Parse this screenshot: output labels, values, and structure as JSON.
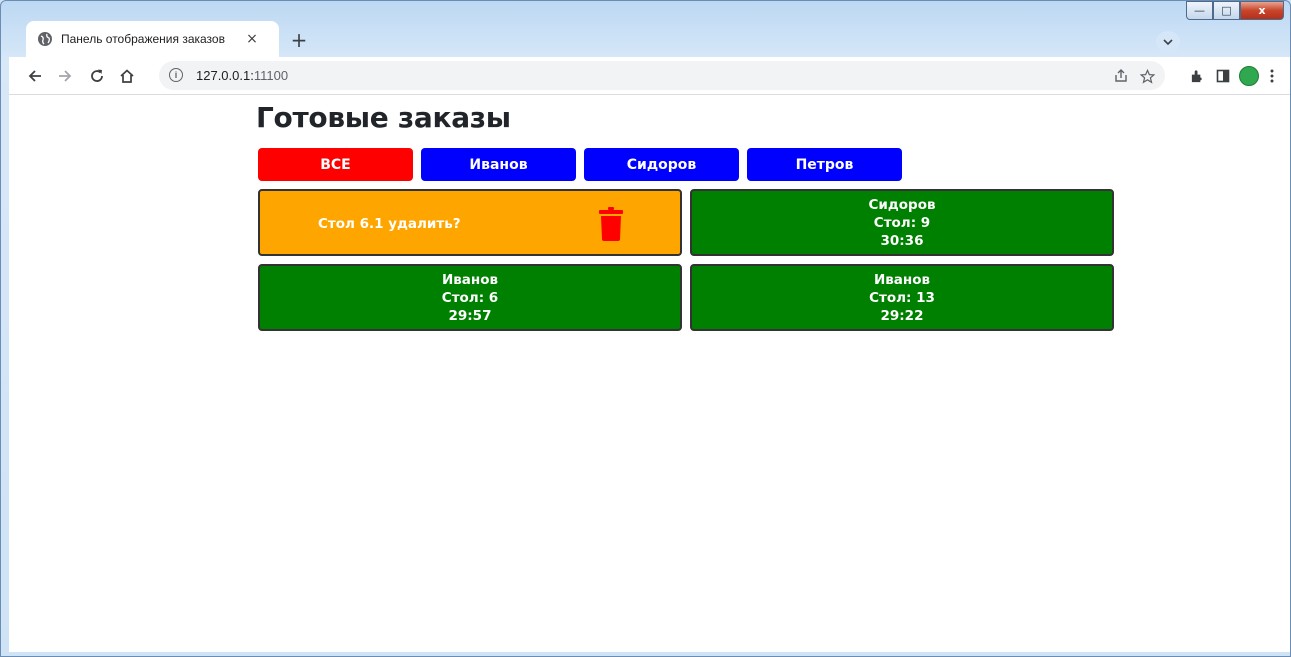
{
  "browser": {
    "tab_title": "Панель отображения заказов",
    "tab_close": "×",
    "new_tab": "+",
    "url_host": "127.0.0.1:",
    "url_port": "11100",
    "window_buttons": {
      "minimize": "—",
      "maximize": "□",
      "close": "x"
    }
  },
  "page": {
    "title": "Готовые заказы",
    "filters": [
      {
        "label": "ВСЕ",
        "color": "#ff0000"
      },
      {
        "label": "Иванов",
        "color": "#0000ff"
      },
      {
        "label": "Сидоров",
        "color": "#0000ff"
      },
      {
        "label": "Петров",
        "color": "#0000ff"
      }
    ],
    "confirm_card": {
      "text": "Стол 6.1 удалить?",
      "color": "#ffa500",
      "icon": "trash-icon"
    },
    "orders": [
      {
        "waiter": "Сидоров",
        "table": "Стол: 9",
        "time": "30:36",
        "color": "#008000"
      },
      {
        "waiter": "Иванов",
        "table": "Стол: 6",
        "time": "29:57",
        "color": "#008000"
      },
      {
        "waiter": "Иванов",
        "table": "Стол: 13",
        "time": "29:22",
        "color": "#008000"
      }
    ]
  }
}
